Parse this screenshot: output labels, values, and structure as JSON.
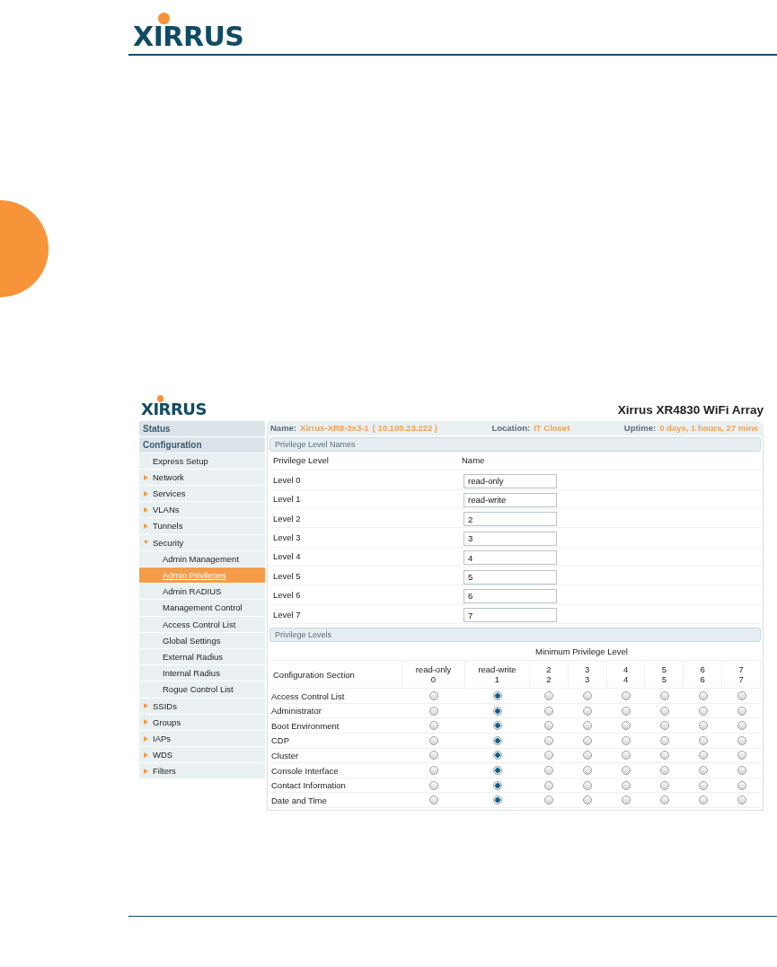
{
  "document": {
    "logo": "XIRRUS"
  },
  "app": {
    "logo": "XIRRUS",
    "title": "Xirrus XR4830 WiFi Array",
    "info": [
      {
        "label": "Name:",
        "values": [
          "Xirrus-XR8-3x3-1",
          "( 10.100.23.222 )"
        ]
      },
      {
        "label": "Location:",
        "values": [
          "IT Closet"
        ]
      },
      {
        "label": "Uptime:",
        "values": [
          "0 days, 1 hours, 27 mins"
        ]
      }
    ]
  },
  "sidebar": [
    {
      "kind": "section",
      "label": "Status"
    },
    {
      "kind": "section",
      "label": "Configuration"
    },
    {
      "kind": "link",
      "label": "Express Setup"
    },
    {
      "kind": "folder",
      "label": "Network",
      "expanded": false
    },
    {
      "kind": "folder",
      "label": "Services",
      "expanded": false
    },
    {
      "kind": "folder",
      "label": "VLANs",
      "expanded": false
    },
    {
      "kind": "folder",
      "label": "Tunnels",
      "expanded": false
    },
    {
      "kind": "folder",
      "label": "Security",
      "expanded": true,
      "children": [
        {
          "label": "Admin Management",
          "selected": false
        },
        {
          "label": "Admin Privileges",
          "selected": true
        },
        {
          "label": "Admin RADIUS",
          "selected": false
        },
        {
          "label": "Management Control",
          "selected": false
        },
        {
          "label": "Access Control List",
          "selected": false
        },
        {
          "label": "Global Settings",
          "selected": false
        },
        {
          "label": "External Radius",
          "selected": false
        },
        {
          "label": "Internal Radius",
          "selected": false
        },
        {
          "label": "Rogue Control List",
          "selected": false
        }
      ]
    },
    {
      "kind": "folder",
      "label": "SSIDs",
      "expanded": false
    },
    {
      "kind": "folder",
      "label": "Groups",
      "expanded": false
    },
    {
      "kind": "folder",
      "label": "IAPs",
      "expanded": false
    },
    {
      "kind": "folder",
      "label": "WDS",
      "expanded": false
    },
    {
      "kind": "folder",
      "label": "Filters",
      "expanded": false
    }
  ],
  "names_section": {
    "title": "Privilege Level Names",
    "columns": [
      "Privilege Level",
      "Name"
    ],
    "rows": [
      {
        "label": "Level 0",
        "value": "read-only"
      },
      {
        "label": "Level 1",
        "value": "read-write"
      },
      {
        "label": "Level 2",
        "value": "2"
      },
      {
        "label": "Level 3",
        "value": "3"
      },
      {
        "label": "Level 4",
        "value": "4"
      },
      {
        "label": "Level 5",
        "value": "5"
      },
      {
        "label": "Level 6",
        "value": "6"
      },
      {
        "label": "Level 7",
        "value": "7"
      }
    ]
  },
  "levels_section": {
    "title": "Privilege Levels",
    "group_header": "Minimum Privilege Level",
    "first_column": "Configuration Section",
    "columns": [
      {
        "name": "read-only",
        "number": "0"
      },
      {
        "name": "read-write",
        "number": "1"
      },
      {
        "name": "2",
        "number": "2"
      },
      {
        "name": "3",
        "number": "3"
      },
      {
        "name": "4",
        "number": "4"
      },
      {
        "name": "5",
        "number": "5"
      },
      {
        "name": "6",
        "number": "6"
      },
      {
        "name": "7",
        "number": "7"
      }
    ],
    "rows": [
      {
        "section": "Access Control List",
        "options": [
          {
            "selected": false
          },
          {
            "selected": true
          },
          {
            "selected": false
          },
          {
            "selected": false
          },
          {
            "selected": false
          },
          {
            "selected": false
          },
          {
            "selected": false
          },
          {
            "selected": false
          }
        ]
      },
      {
        "section": "Administrator",
        "options": [
          {
            "selected": false
          },
          {
            "selected": true
          },
          {
            "selected": false
          },
          {
            "selected": false
          },
          {
            "selected": false
          },
          {
            "selected": false
          },
          {
            "selected": false
          },
          {
            "selected": false
          }
        ]
      },
      {
        "section": "Boot Environment",
        "options": [
          {
            "selected": false
          },
          {
            "selected": true
          },
          {
            "selected": false
          },
          {
            "selected": false
          },
          {
            "selected": false
          },
          {
            "selected": false
          },
          {
            "selected": false
          },
          {
            "selected": false
          }
        ]
      },
      {
        "section": "CDP",
        "options": [
          {
            "selected": false
          },
          {
            "selected": true
          },
          {
            "selected": false
          },
          {
            "selected": false
          },
          {
            "selected": false
          },
          {
            "selected": false
          },
          {
            "selected": false
          },
          {
            "selected": false
          }
        ]
      },
      {
        "section": "Cluster",
        "options": [
          {
            "selected": false
          },
          {
            "selected": true
          },
          {
            "selected": false
          },
          {
            "selected": false
          },
          {
            "selected": false
          },
          {
            "selected": false
          },
          {
            "selected": false
          },
          {
            "selected": false
          }
        ]
      },
      {
        "section": "Console Interface",
        "options": [
          {
            "selected": false
          },
          {
            "selected": true
          },
          {
            "selected": false
          },
          {
            "selected": false
          },
          {
            "selected": false
          },
          {
            "selected": false
          },
          {
            "selected": false
          },
          {
            "selected": false
          }
        ]
      },
      {
        "section": "Contact Information",
        "options": [
          {
            "selected": false
          },
          {
            "selected": true
          },
          {
            "selected": false
          },
          {
            "selected": false
          },
          {
            "selected": false
          },
          {
            "selected": false
          },
          {
            "selected": false
          },
          {
            "selected": false
          }
        ]
      },
      {
        "section": "Date and Time",
        "options": [
          {
            "selected": false
          },
          {
            "selected": true
          },
          {
            "selected": false
          },
          {
            "selected": false
          },
          {
            "selected": false
          },
          {
            "selected": false
          },
          {
            "selected": false
          },
          {
            "selected": false
          }
        ]
      }
    ]
  }
}
